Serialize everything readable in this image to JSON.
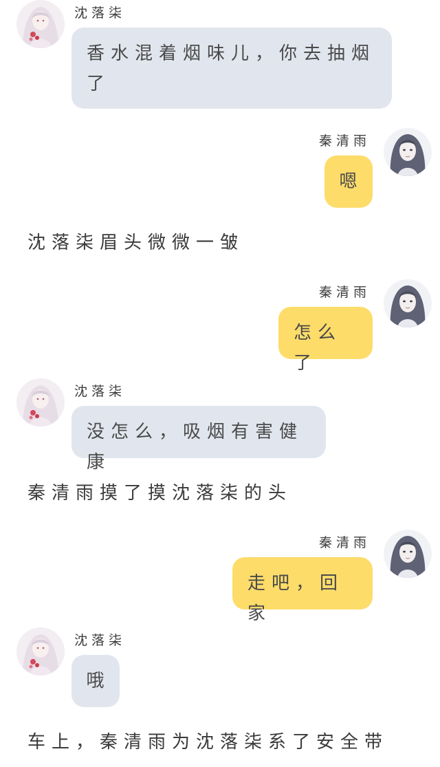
{
  "characters": {
    "left": {
      "name": "沈落柒",
      "avatar_icon": "girl-avatar-white-hair-icon"
    },
    "right": {
      "name": "秦清雨",
      "avatar_icon": "girl-avatar-dark-hair-icon"
    }
  },
  "colors": {
    "left_bubble": "#e1e6ee",
    "right_bubble": "#fddc6a",
    "background": "#ffffff"
  },
  "messages": [
    {
      "side": "left",
      "name": "沈落柒",
      "text": "香水混着烟味儿，你去抽烟了"
    },
    {
      "side": "right",
      "name": "秦清雨",
      "text": "嗯"
    },
    {
      "side": "narration",
      "text": "沈落柒眉头微微一皱"
    },
    {
      "side": "right",
      "name": "秦清雨",
      "text": "怎么了"
    },
    {
      "side": "left",
      "name": "沈落柒",
      "text": "没怎么，吸烟有害健康"
    },
    {
      "side": "narration",
      "text": "秦清雨摸了摸沈落柒的头"
    },
    {
      "side": "right",
      "name": "秦清雨",
      "text": "走吧，回家"
    },
    {
      "side": "left",
      "name": "沈落柒",
      "text": "哦"
    },
    {
      "side": "narration",
      "text": "车上，秦清雨为沈落柒系了安全带"
    }
  ]
}
